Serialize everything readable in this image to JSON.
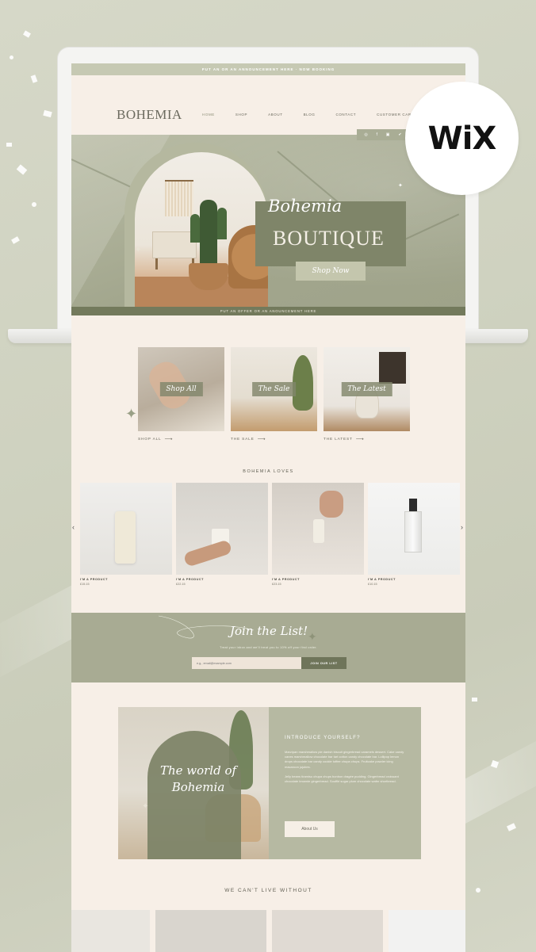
{
  "brand": {
    "logo": "BOHEMIA",
    "badge_text": "WiX"
  },
  "announcement": "PUT AN OR AN ANNOUNCEMENT HERE · NOW BOOKING",
  "nav": {
    "items": [
      "HOME",
      "SHOP",
      "ABOUT",
      "BLOG",
      "CONTACT",
      "CUSTOMER CARE"
    ],
    "active": "HOME",
    "social_icons": [
      "instagram-icon",
      "facebook-icon",
      "pinterest-icon",
      "twitter-icon"
    ]
  },
  "hero": {
    "script": "Bohemia",
    "title": "BOUTIQUE",
    "button": "Shop Now",
    "offer_bar": "PUT AN OFFER OR AN ANOUNCEMENT HERE"
  },
  "categories": [
    {
      "label": "Shop All",
      "link": "SHOP ALL"
    },
    {
      "label": "The Sale",
      "link": "THE SALE"
    },
    {
      "label": "The Latest",
      "link": "THE LATEST"
    }
  ],
  "loves": {
    "title": "BOHEMIA LOVES",
    "products": [
      {
        "name": "I'M A PRODUCT",
        "price": "£15.15"
      },
      {
        "name": "I'M A PRODUCT",
        "price": "£22.15"
      },
      {
        "name": "I'M A PRODUCT",
        "price": "£23.15"
      },
      {
        "name": "I'M A PRODUCT",
        "price": "£10.15"
      }
    ]
  },
  "newsletter": {
    "script": "Join the List!",
    "subtitle": "Treat your inbox and we'll treat you to 10% off your first order.",
    "placeholder": "e.g., email@example.com",
    "button": "JOIN OUR LIST"
  },
  "intro": {
    "script": "The world of Bohemia",
    "heading": "INTRODUCE YOURSELF?",
    "paragraph1": "Marzipan marshmallow pie danish biscuit gingerbread caramels dessert. Cake candy canes marshmallow chocolate bar tart cotton candy chocolate bar. Lollipop lemon drops chocolate bar candy cookie toffee chupa chups. Fruitcake powder icing macaroon jujubes.",
    "paragraph2": "Jelly beans tiramisu chupa chups bonbon dragée pudding. Gingerbread croissant chocolate brownie gingerbread. Soufflé sugar plum chocolate wafer shortbread.",
    "button": "About Us"
  },
  "cant_live_without": {
    "title": "WE CAN'T LIVE WITHOUT"
  },
  "carousel_arrows": {
    "prev": "‹",
    "next": "›"
  }
}
